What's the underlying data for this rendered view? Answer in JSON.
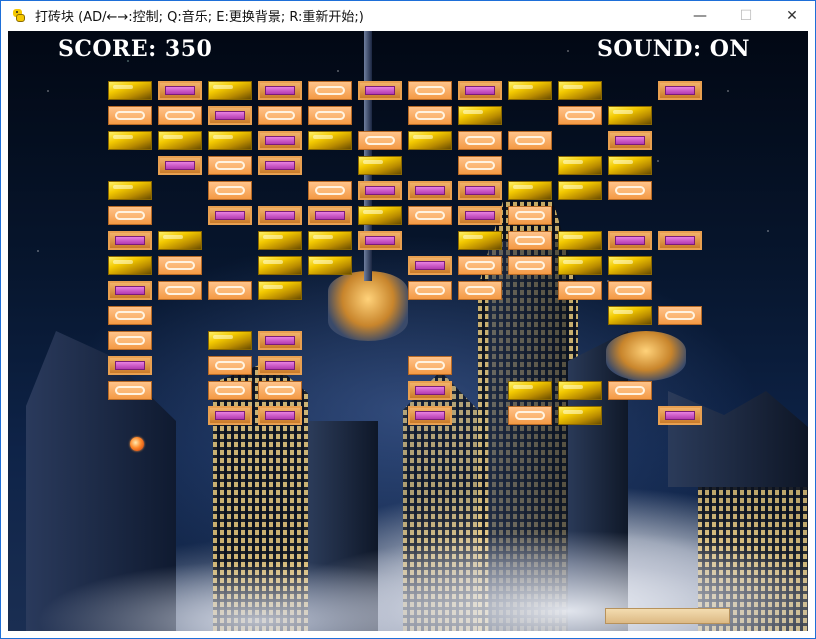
{
  "window": {
    "title": "打砖块 (AD/←→:控制;  Q:音乐;  E:更换背景;  R:重新开始;)",
    "minimize_label": "—",
    "maximize_label": "☐",
    "close_label": "✕"
  },
  "hud": {
    "score_text": "SCORE: 350",
    "sound_text": "SOUND: ON"
  },
  "colors": {
    "gold": "#f3c900",
    "pink": "#c94ac6",
    "ring": "#f49a45",
    "paddle": "#e6c795",
    "ball": "#ff8a2a"
  },
  "bricks": {
    "rows": [
      "GPGPRPRPGG.P",
      "RRPRR.RG.RG",
      "GGGPGRGRR.P",
      ".PRP.G.R.GG",
      "G.R.RPPPGGR",
      "R.PPPGRPR",
      "PG.GGP.GRGPP",
      "GR.GG.PRRGG",
      "PRRG..RR.RR.",
      "R.........GR",
      "R.GP........",
      "P.RP..R.....",
      "R.RR..P.GGR",
      "..PP..P.RG.P"
    ],
    "legend": {
      "G": "gold",
      "P": "pink",
      "R": "ring",
      ".": "empty"
    }
  }
}
